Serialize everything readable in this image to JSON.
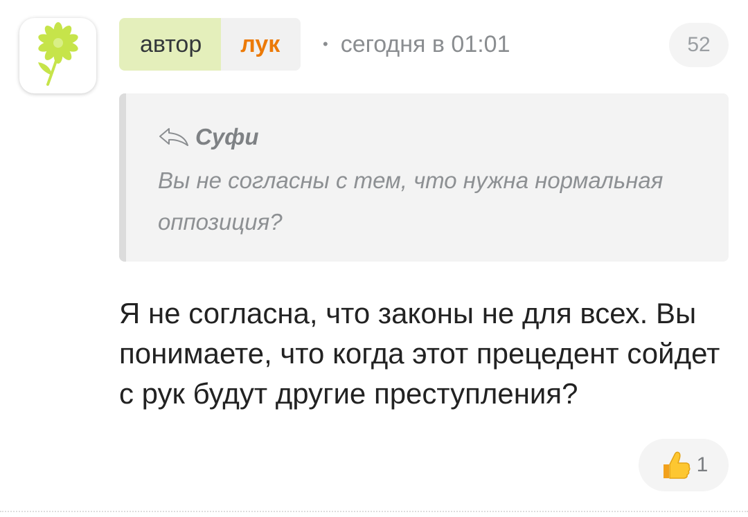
{
  "header": {
    "author_label": "автор",
    "nickname": "лук",
    "separator": "•",
    "timestamp": "сегодня в 01:01",
    "rating": "52"
  },
  "quote": {
    "reply_to": "Суфи",
    "text": "Вы не согласны с тем, что нужна нормальная оппозиция?"
  },
  "comment": {
    "text": "Я не согласна, что законы не для всех. Вы понимаете, что когда этот прецедент сойдет с рук будут другие преступления?"
  },
  "reactions": {
    "like_count": "1"
  },
  "icons": {
    "avatar": "flower-icon",
    "reply": "reply-arrow-icon",
    "like": "thumbs-up-icon"
  },
  "colors": {
    "author_badge_bg": "#e4efbb",
    "nickname": "#ec7a08",
    "flower": "#c6e44a"
  }
}
